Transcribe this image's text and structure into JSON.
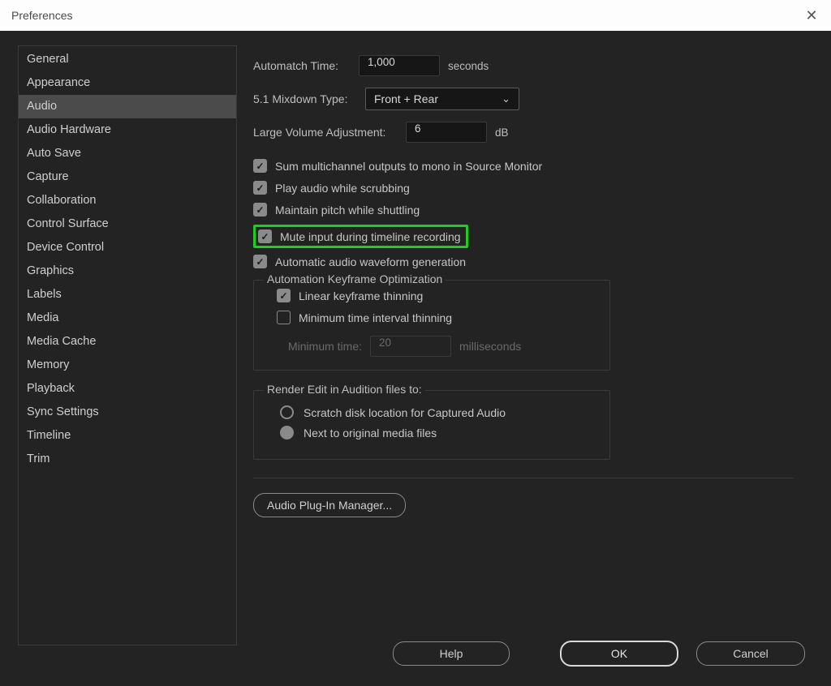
{
  "titlebar": {
    "title": "Preferences",
    "close_icon": "✕"
  },
  "sidebar": {
    "items": [
      {
        "label": "General"
      },
      {
        "label": "Appearance"
      },
      {
        "label": "Audio",
        "selected": true
      },
      {
        "label": "Audio Hardware"
      },
      {
        "label": "Auto Save"
      },
      {
        "label": "Capture"
      },
      {
        "label": "Collaboration"
      },
      {
        "label": "Control Surface"
      },
      {
        "label": "Device Control"
      },
      {
        "label": "Graphics"
      },
      {
        "label": "Labels"
      },
      {
        "label": "Media"
      },
      {
        "label": "Media Cache"
      },
      {
        "label": "Memory"
      },
      {
        "label": "Playback"
      },
      {
        "label": "Sync Settings"
      },
      {
        "label": "Timeline"
      },
      {
        "label": "Trim"
      }
    ]
  },
  "content": {
    "automatch_label": "Automatch Time:",
    "automatch_value": "1,000",
    "automatch_suffix": "seconds",
    "mixdown_label": "5.1 Mixdown Type:",
    "mixdown_value": "Front + Rear",
    "lva_label": "Large Volume Adjustment:",
    "lva_value": "6",
    "lva_suffix": "dB",
    "checks": {
      "c0": "Sum multichannel outputs to mono in Source Monitor",
      "c1": "Play audio while scrubbing",
      "c2": "Maintain pitch while shuttling",
      "c3": "Mute input during timeline recording",
      "c4": "Automatic audio waveform generation"
    },
    "ako": {
      "legend": "Automation Keyframe Optimization",
      "linear": "Linear keyframe thinning",
      "minint": "Minimum time interval thinning",
      "min_label": "Minimum time:",
      "min_value": "20",
      "min_suffix": "milliseconds"
    },
    "render": {
      "legend": "Render Edit in Audition files to:",
      "r0": "Scratch disk location for Captured Audio",
      "r1": "Next to original media files"
    },
    "plugin_btn": "Audio Plug-In Manager..."
  },
  "buttons": {
    "help": "Help",
    "ok": "OK",
    "cancel": "Cancel"
  }
}
